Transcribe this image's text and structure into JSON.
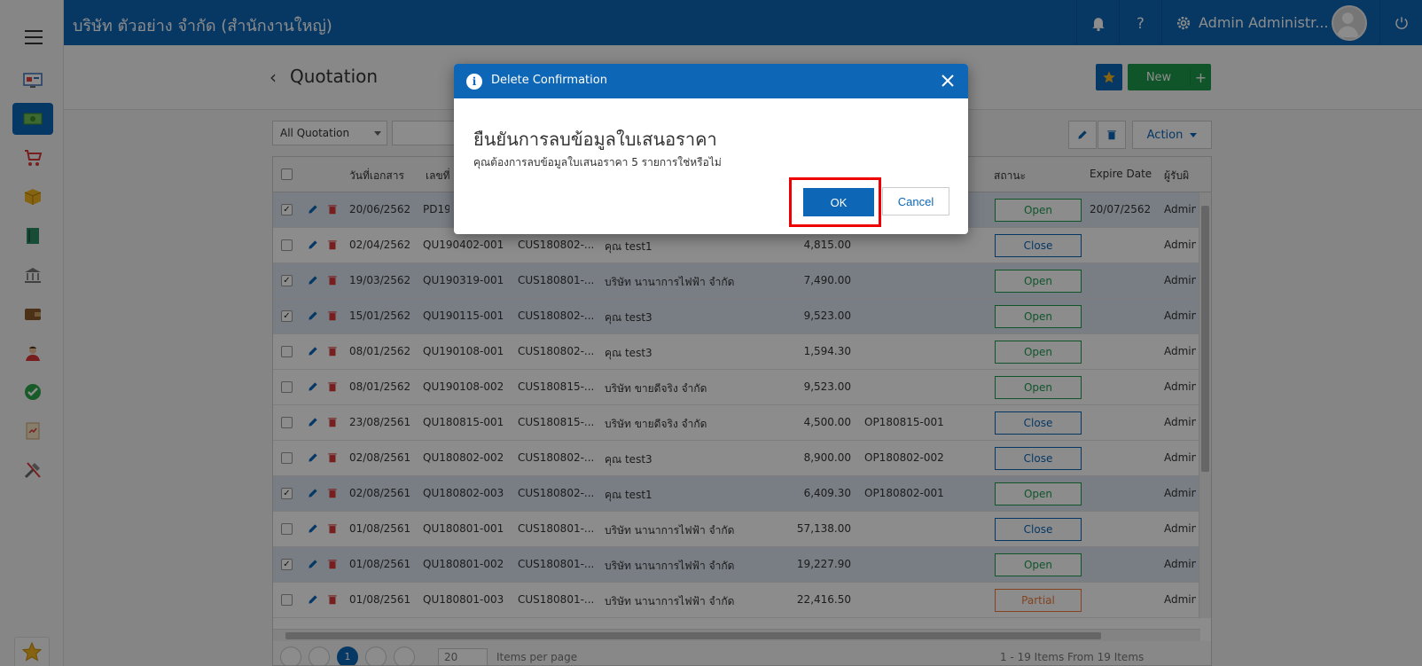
{
  "topbar": {
    "company": "บริษัท ตัวอย่าง จำกัด (สำนักงานใหญ่)",
    "username": "Admin Administr..."
  },
  "page": {
    "title": "Quotation",
    "star_label": "★",
    "new_label": "New",
    "new_plus": "+"
  },
  "toolbar": {
    "filter_value": "All Quotation",
    "action_label": "Action"
  },
  "grid": {
    "headers": {
      "doc_date": "วันที่เอกสาร",
      "doc_no": "เลขที่",
      "status": "สถานะ",
      "expire": "Expire Date",
      "owner": "ผู้รับผิ"
    },
    "rows": [
      {
        "checked": true,
        "date": "20/06/2562",
        "no": "PD190",
        "cust": "",
        "name": "",
        "amount": "",
        "ref": "",
        "status": "Open",
        "expire": "20/07/2562",
        "owner": "Admin"
      },
      {
        "checked": false,
        "date": "02/04/2562",
        "no": "QU190402-001",
        "cust": "CUS180802-...",
        "name": "คุณ test1",
        "amount": "4,815.00",
        "ref": "",
        "status": "Close",
        "expire": "",
        "owner": "Admin"
      },
      {
        "checked": true,
        "date": "19/03/2562",
        "no": "QU190319-001",
        "cust": "CUS180801-...",
        "name": "บริษัท นานาการไฟฟ้า จำกัด",
        "amount": "7,490.00",
        "ref": "",
        "status": "Open",
        "expire": "",
        "owner": "Admin"
      },
      {
        "checked": true,
        "date": "15/01/2562",
        "no": "QU190115-001",
        "cust": "CUS180802-...",
        "name": "คุณ test3",
        "amount": "9,523.00",
        "ref": "",
        "status": "Open",
        "expire": "",
        "owner": "Admin"
      },
      {
        "checked": false,
        "date": "08/01/2562",
        "no": "QU190108-001",
        "cust": "CUS180802-...",
        "name": "คุณ test3",
        "amount": "1,594.30",
        "ref": "",
        "status": "Open",
        "expire": "",
        "owner": "Admin"
      },
      {
        "checked": false,
        "date": "08/01/2562",
        "no": "QU190108-002",
        "cust": "CUS180815-...",
        "name": "บริษัท ขายดีจริง จำกัด",
        "amount": "9,523.00",
        "ref": "",
        "status": "Open",
        "expire": "",
        "owner": "Admin"
      },
      {
        "checked": false,
        "date": "23/08/2561",
        "no": "QU180815-001",
        "cust": "CUS180815-...",
        "name": "บริษัท ขายดีจริง จำกัด",
        "amount": "4,500.00",
        "ref": "OP180815-001",
        "status": "Close",
        "expire": "",
        "owner": "Admin"
      },
      {
        "checked": false,
        "date": "02/08/2561",
        "no": "QU180802-002",
        "cust": "CUS180802-...",
        "name": "คุณ test3",
        "amount": "8,900.00",
        "ref": "OP180802-002",
        "status": "Close",
        "expire": "",
        "owner": "Admin"
      },
      {
        "checked": true,
        "date": "02/08/2561",
        "no": "QU180802-003",
        "cust": "CUS180802-...",
        "name": "คุณ test1",
        "amount": "6,409.30",
        "ref": "OP180802-001",
        "status": "Open",
        "expire": "",
        "owner": "Admin"
      },
      {
        "checked": false,
        "date": "01/08/2561",
        "no": "QU180801-001",
        "cust": "CUS180801-...",
        "name": "บริษัท นานาการไฟฟ้า จำกัด",
        "amount": "57,138.00",
        "ref": "",
        "status": "Close",
        "expire": "",
        "owner": "Admin"
      },
      {
        "checked": true,
        "date": "01/08/2561",
        "no": "QU180801-002",
        "cust": "CUS180801-...",
        "name": "บริษัท นานาการไฟฟ้า จำกัด",
        "amount": "19,227.90",
        "ref": "",
        "status": "Open",
        "expire": "",
        "owner": "Admin"
      },
      {
        "checked": false,
        "date": "01/08/2561",
        "no": "QU180801-003",
        "cust": "CUS180801-...",
        "name": "บริษัท นานาการไฟฟ้า จำกัด",
        "amount": "22,416.50",
        "ref": "",
        "status": "Partial",
        "expire": "",
        "owner": "Admin"
      }
    ],
    "pager": {
      "current_page": "1",
      "page_size": "20",
      "page_size_label": "Items per page",
      "summary": "1 - 19 Items From 19 Items"
    }
  },
  "status_colors": {
    "Open": "#1e9c4b",
    "Close": "#0b66b8",
    "Partial": "#f07a3a"
  },
  "modal": {
    "title": "Delete Confirmation",
    "heading": "ยืนยันการลบข้อมูลใบเสนอราคา",
    "message": "คุณต้องการลบข้อมูลใบเสนอราคา 5 รายการใช่หรือไม่",
    "ok_label": "OK",
    "cancel_label": "Cancel"
  },
  "colors": {
    "brand": "#0d66b6",
    "highlight": "#e00000"
  }
}
